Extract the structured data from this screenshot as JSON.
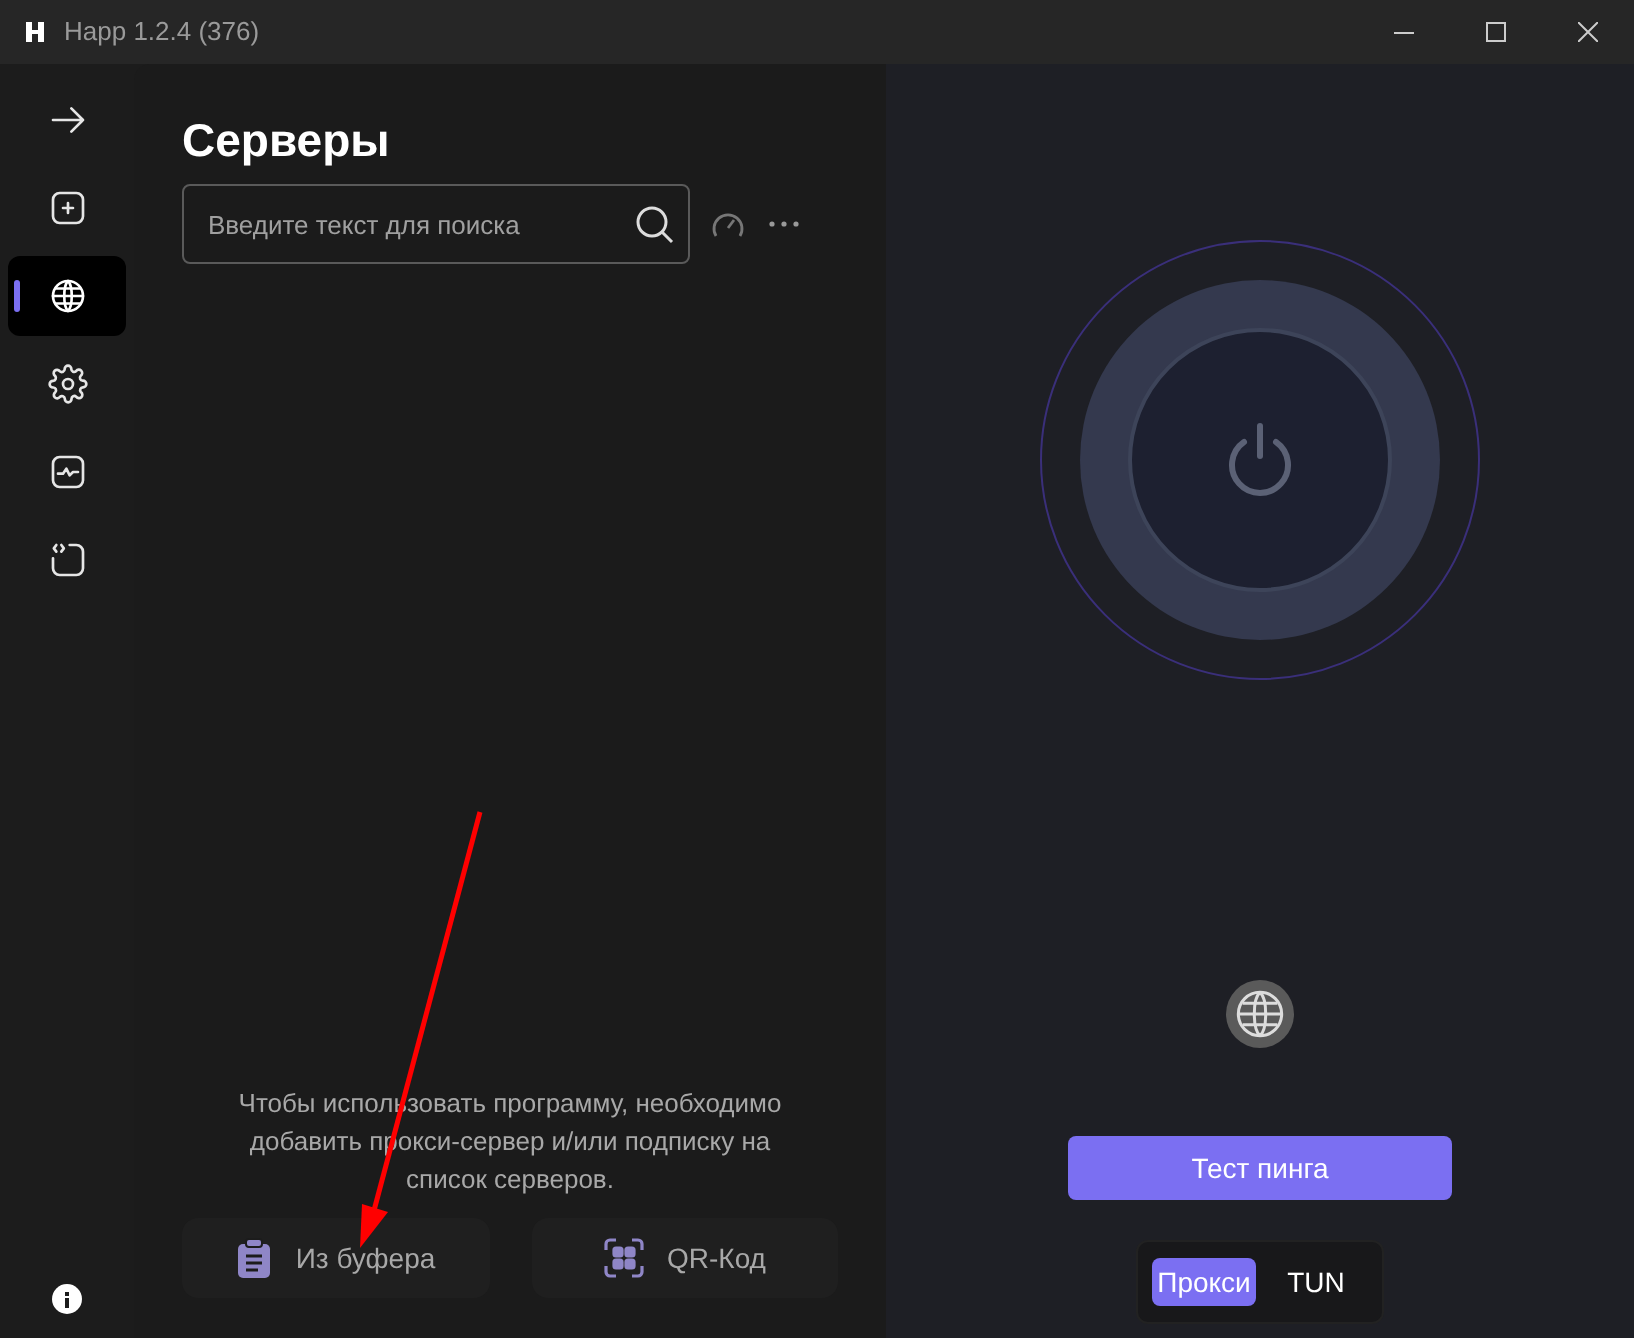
{
  "window": {
    "title": "Happ 1.2.4 (376)"
  },
  "sidebar": {
    "items": [
      {
        "kind": "arrow",
        "selected": false
      },
      {
        "kind": "add",
        "selected": false
      },
      {
        "kind": "globe",
        "selected": true
      },
      {
        "kind": "gear",
        "selected": false
      },
      {
        "kind": "monitor",
        "selected": false
      },
      {
        "kind": "code",
        "selected": false
      }
    ]
  },
  "servers": {
    "title": "Серверы",
    "search": {
      "placeholder": "Введите текст для поиска"
    },
    "empty_message": "Чтобы использовать программу, необходимо добавить прокси-сервер и/или подписку на список серверов.",
    "buttons": [
      {
        "kind": "clipboard",
        "label": "Из буфера"
      },
      {
        "kind": "qr",
        "label": "QR-Код"
      }
    ]
  },
  "connection": {
    "ping_button": "Тест пинга",
    "modes": [
      {
        "label": "Прокси",
        "selected": true
      },
      {
        "label": "TUN",
        "selected": false
      }
    ]
  }
}
